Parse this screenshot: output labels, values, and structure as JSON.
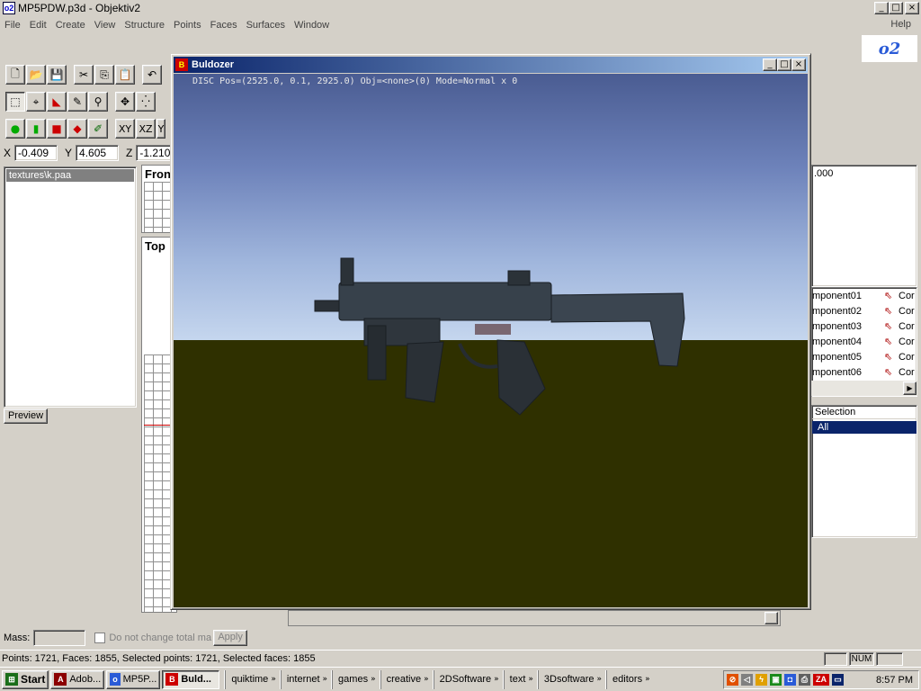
{
  "app": {
    "title": "MP5PDW.p3d - Objektiv2",
    "title_controls": [
      "_",
      "□",
      "×"
    ]
  },
  "menu": {
    "items": [
      "File",
      "Edit",
      "Create",
      "View",
      "Structure",
      "Points",
      "Faces",
      "Surfaces",
      "Window"
    ],
    "help": "Help"
  },
  "logo_text": "o2",
  "toolbar": {
    "row1": [
      "new-icon",
      "open-icon",
      "save-icon",
      "cut-icon",
      "copy-icon",
      "paste-icon",
      "undo-icon"
    ],
    "row2": [
      "select-icon",
      "lasso-icon",
      "select-faces-icon",
      "paint-icon",
      "zoom-icon",
      "move-icon",
      "points-icon"
    ],
    "row3": [
      "animation-icon",
      "mass-icon",
      "marker-icon",
      "mark-icon",
      "edit-icon"
    ],
    "plane_buttons": [
      "XY",
      "XZ",
      "Y"
    ]
  },
  "coords": {
    "x_label": "X",
    "x_value": "-0.409",
    "y_label": "Y",
    "y_value": "4.605",
    "z_label": "Z",
    "z_value": "-1.210"
  },
  "textures": {
    "items": [
      "textures\\k.paa"
    ],
    "preview_label": "Preview"
  },
  "viewports": {
    "front": "Fron",
    "top": "Top"
  },
  "right_panel": {
    "value": ".000",
    "components": [
      {
        "name": "mponent01",
        "tag": "Cor"
      },
      {
        "name": "mponent02",
        "tag": "Cor"
      },
      {
        "name": "mponent03",
        "tag": "Cor"
      },
      {
        "name": "mponent04",
        "tag": "Cor"
      },
      {
        "name": "mponent05",
        "tag": "Cor"
      },
      {
        "name": "mponent06",
        "tag": "Cor"
      }
    ],
    "selection_header": "Selection",
    "selection_item": "All"
  },
  "buldozer": {
    "title": "Buldozer",
    "hud": "DISC Pos=(2525.0, 0.1, 2925.0) Obj=<none>(0) Mode=Normal x 0",
    "sky_color": "#7d92c4",
    "ground_color": "#2f3000"
  },
  "mass": {
    "label": "Mass:",
    "value": "",
    "checkbox_label": "Do not change total ma",
    "apply_label": "Apply"
  },
  "status": {
    "text": "Points: 1721, Faces: 1855, Selected points: 1721, Selected faces: 1855",
    "num": "NUM"
  },
  "taskbar": {
    "start": "Start",
    "tasks": [
      "Adob...",
      "MP5P...",
      "Buld..."
    ],
    "quicklaunch": [
      "quiktime",
      "internet",
      "games",
      "creative",
      "2DSoftware",
      "text",
      "3Dsoftware",
      "editors"
    ],
    "chevron": "»",
    "tray_label": "ZA",
    "clock": "8:57 PM"
  }
}
